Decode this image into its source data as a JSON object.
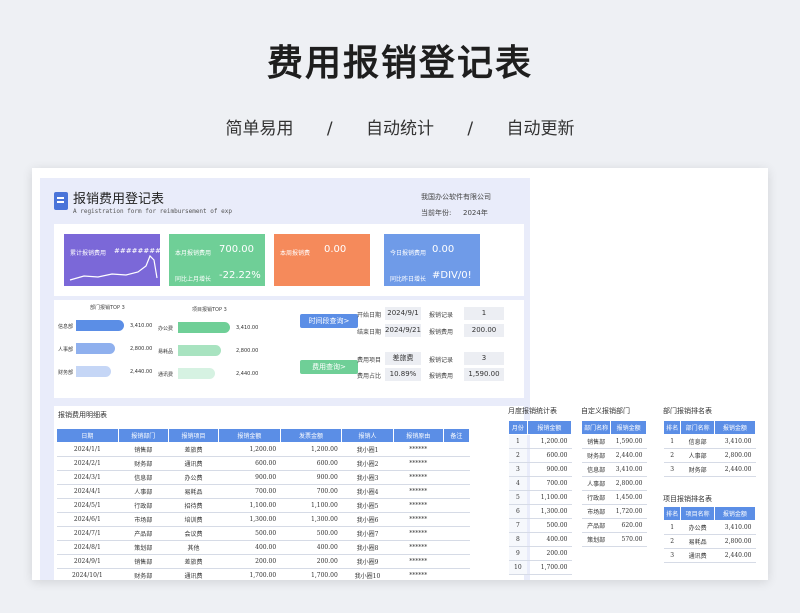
{
  "hero": {
    "title": "费用报销登记表",
    "features": [
      "简单易用",
      "/",
      "自动统计",
      "/",
      "自动更新"
    ]
  },
  "header": {
    "title": "报销费用登记表",
    "subtitle": "A registration form for reimbursement of exp",
    "company": "我国办公软件有限公司",
    "year_label": "当前年份:",
    "year_value": "2024年"
  },
  "cards": [
    {
      "label": "累计报销费用",
      "value": "########",
      "compare_label": "",
      "compare_value": "",
      "color": "#7b68d8"
    },
    {
      "label": "本月报销费用",
      "value": "700.00",
      "compare_label": "同比上月增长",
      "compare_value": "-22.22%",
      "color": "#6fcf97"
    },
    {
      "label": "本周报销费",
      "value": "0.00",
      "compare_label": "",
      "compare_value": "",
      "color": "#f58a5b"
    },
    {
      "label": "今日报销费用",
      "value": "0.00",
      "compare_label": "同比昨日增长",
      "compare_value": "#DIV/0!",
      "color": "#6f9be8"
    }
  ],
  "dept_chart": {
    "title": "部门报销TOP 3",
    "items": [
      {
        "label": "信息部",
        "value": "3,410.00",
        "fraction": 1.0,
        "color": "#5b8ee6"
      },
      {
        "label": "人事部",
        "value": "2,800.00",
        "fraction": 0.82,
        "color": "#8fb0ee"
      },
      {
        "label": "财务部",
        "value": "2,440.00",
        "fraction": 0.72,
        "color": "#c5d6f6"
      }
    ]
  },
  "item_chart": {
    "title": "项目报销TOP 3",
    "items": [
      {
        "label": "办公费",
        "value": "3,410.00",
        "fraction": 1.0,
        "color": "#6fcf97"
      },
      {
        "label": "易耗品",
        "value": "2,800.00",
        "fraction": 0.82,
        "color": "#a8e3c0"
      },
      {
        "label": "通讯费",
        "value": "2,440.00",
        "fraction": 0.72,
        "color": "#d6f2e2"
      }
    ]
  },
  "query": {
    "time_button": "时间段查询>",
    "expense_button": "费用查询>",
    "start_label": "开始日期",
    "start_value": "2024/9/1",
    "end_label": "结束日期",
    "end_value": "2024/9/21",
    "record_label_1": "报销记录",
    "record_value_1": "1",
    "amount_label_1": "报销费用",
    "amount_value_1": "200.00",
    "type_label": "费用项目",
    "type_value": "差旅费",
    "ratio_label": "费用占比",
    "ratio_value": "10.89%",
    "record_label_2": "报销记录",
    "record_value_2": "3",
    "amount_label_2": "报销费用",
    "amount_value_2": "1,590.00"
  },
  "detail": {
    "title": "报销费用明细表",
    "columns": [
      "日期",
      "报销部门",
      "报销项目",
      "报销金额",
      "发票金额",
      "报销人",
      "报销原由",
      "备注"
    ],
    "rows": [
      [
        "2024/1/1",
        "销售部",
        "差旅费",
        "1,200.00",
        "1,200.00",
        "我小圈1",
        "******",
        ""
      ],
      [
        "2024/2/1",
        "财务部",
        "通讯费",
        "600.00",
        "600.00",
        "我小圈2",
        "******",
        ""
      ],
      [
        "2024/3/1",
        "信息部",
        "办公费",
        "900.00",
        "900.00",
        "我小圈3",
        "******",
        ""
      ],
      [
        "2024/4/1",
        "人事部",
        "易耗品",
        "700.00",
        "700.00",
        "我小圈4",
        "******",
        ""
      ],
      [
        "2024/5/1",
        "行政部",
        "招待费",
        "1,100.00",
        "1,100.00",
        "我小圈5",
        "******",
        ""
      ],
      [
        "2024/6/1",
        "市场部",
        "培训费",
        "1,300.00",
        "1,300.00",
        "我小圈6",
        "******",
        ""
      ],
      [
        "2024/7/1",
        "产品部",
        "会议费",
        "500.00",
        "500.00",
        "我小圈7",
        "******",
        ""
      ],
      [
        "2024/8/1",
        "策划部",
        "其他",
        "400.00",
        "400.00",
        "我小圈8",
        "******",
        ""
      ],
      [
        "2024/9/1",
        "销售部",
        "差旅费",
        "200.00",
        "200.00",
        "我小圈9",
        "******",
        ""
      ],
      [
        "2024/10/1",
        "财务部",
        "通讯费",
        "1,700.00",
        "1,700.00",
        "我小圈10",
        "******",
        ""
      ]
    ]
  },
  "monthly": {
    "title": "月度报销统计表",
    "columns": [
      "月份",
      "报销金额"
    ],
    "rows": [
      [
        "1",
        "1,200.00"
      ],
      [
        "2",
        "600.00"
      ],
      [
        "3",
        "900.00"
      ],
      [
        "4",
        "700.00"
      ],
      [
        "5",
        "1,100.00"
      ],
      [
        "6",
        "1,300.00"
      ],
      [
        "7",
        "500.00"
      ],
      [
        "8",
        "400.00"
      ],
      [
        "9",
        "200.00"
      ],
      [
        "10",
        "1,700.00"
      ]
    ]
  },
  "custom_dept": {
    "title": "自定义报销部门",
    "columns": [
      "部门名称",
      "报销金额"
    ],
    "rows": [
      [
        "销售部",
        "1,590.00"
      ],
      [
        "财务部",
        "2,440.00"
      ],
      [
        "信息部",
        "3,410.00"
      ],
      [
        "人事部",
        "2,800.00"
      ],
      [
        "行政部",
        "1,450.00"
      ],
      [
        "市场部",
        "1,720.00"
      ],
      [
        "产品部",
        "620.00"
      ],
      [
        "策划部",
        "570.00"
      ]
    ]
  },
  "dept_rank": {
    "title": "部门报销排名表",
    "columns": [
      "排名",
      "部门名称",
      "报销金额"
    ],
    "rows": [
      [
        "1",
        "信息部",
        "3,410.00"
      ],
      [
        "2",
        "人事部",
        "2,800.00"
      ],
      [
        "3",
        "财务部",
        "2,440.00"
      ]
    ]
  },
  "item_rank": {
    "title": "项目报销排名表",
    "columns": [
      "排名",
      "项目名称",
      "报销金额"
    ],
    "rows": [
      [
        "1",
        "办公费",
        "3,410.00"
      ],
      [
        "2",
        "易耗品",
        "2,800.00"
      ],
      [
        "3",
        "通讯费",
        "2,440.00"
      ]
    ]
  }
}
